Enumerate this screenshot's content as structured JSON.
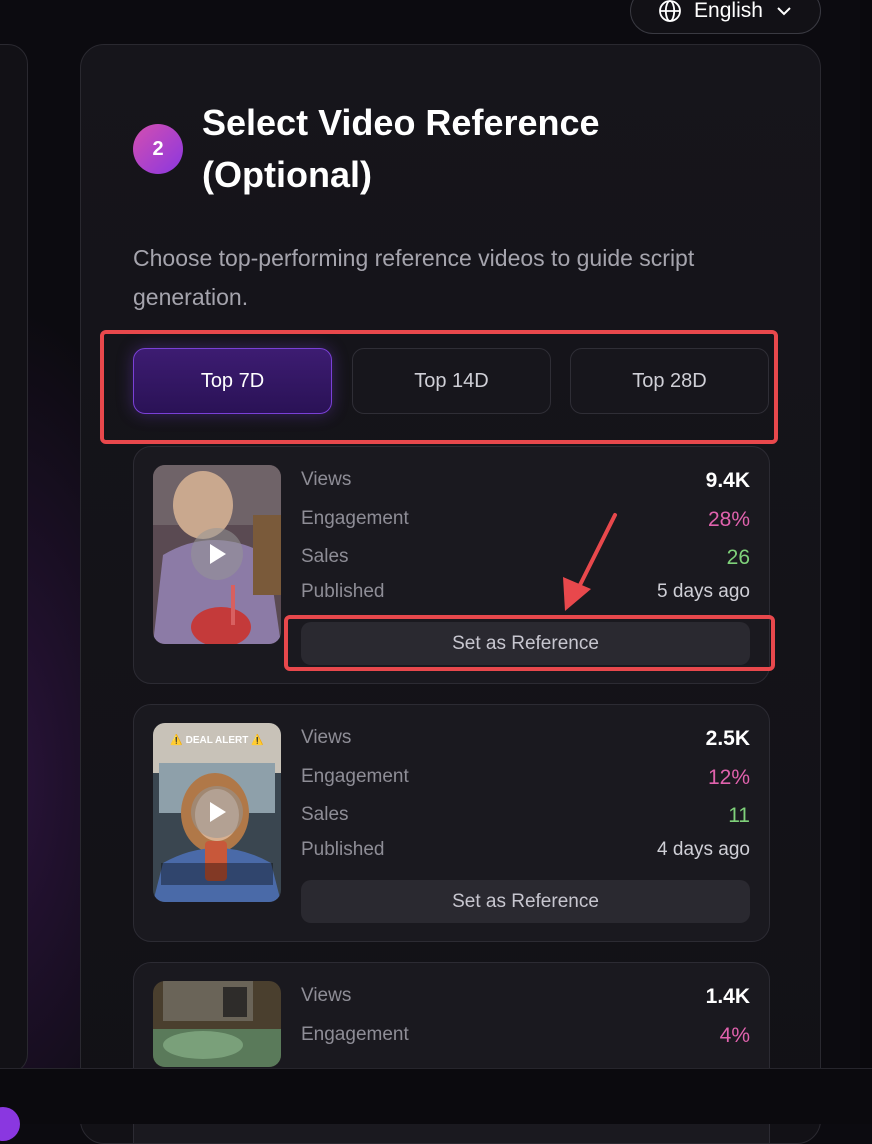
{
  "language": {
    "label": "English",
    "icon": "globe-icon",
    "chevron": "chevron-down-icon"
  },
  "step": {
    "number": "2",
    "title": "Select Video Reference (Optional)",
    "description": "Choose top-performing reference videos to guide script generation."
  },
  "tabs": [
    {
      "label": "Top 7D",
      "active": true
    },
    {
      "label": "Top 14D",
      "active": false
    },
    {
      "label": "Top 28D",
      "active": false
    }
  ],
  "stat_labels": {
    "views": "Views",
    "engagement": "Engagement",
    "sales": "Sales",
    "published": "Published"
  },
  "videos": [
    {
      "views": "9.4K",
      "engagement": "28%",
      "sales": "26",
      "published": "5 days ago",
      "button": "Set as Reference"
    },
    {
      "views": "2.5K",
      "engagement": "12%",
      "sales": "11",
      "published": "4 days ago",
      "button": "Set as Reference",
      "overlay_text": "⚠️ DEAL ALERT ⚠️"
    },
    {
      "views": "1.4K",
      "engagement": "4%"
    }
  ],
  "colors": {
    "accent_purple": "#7a40d6",
    "engagement": "#e062ad",
    "sales": "#7fd17a",
    "highlight": "#e8484c"
  }
}
